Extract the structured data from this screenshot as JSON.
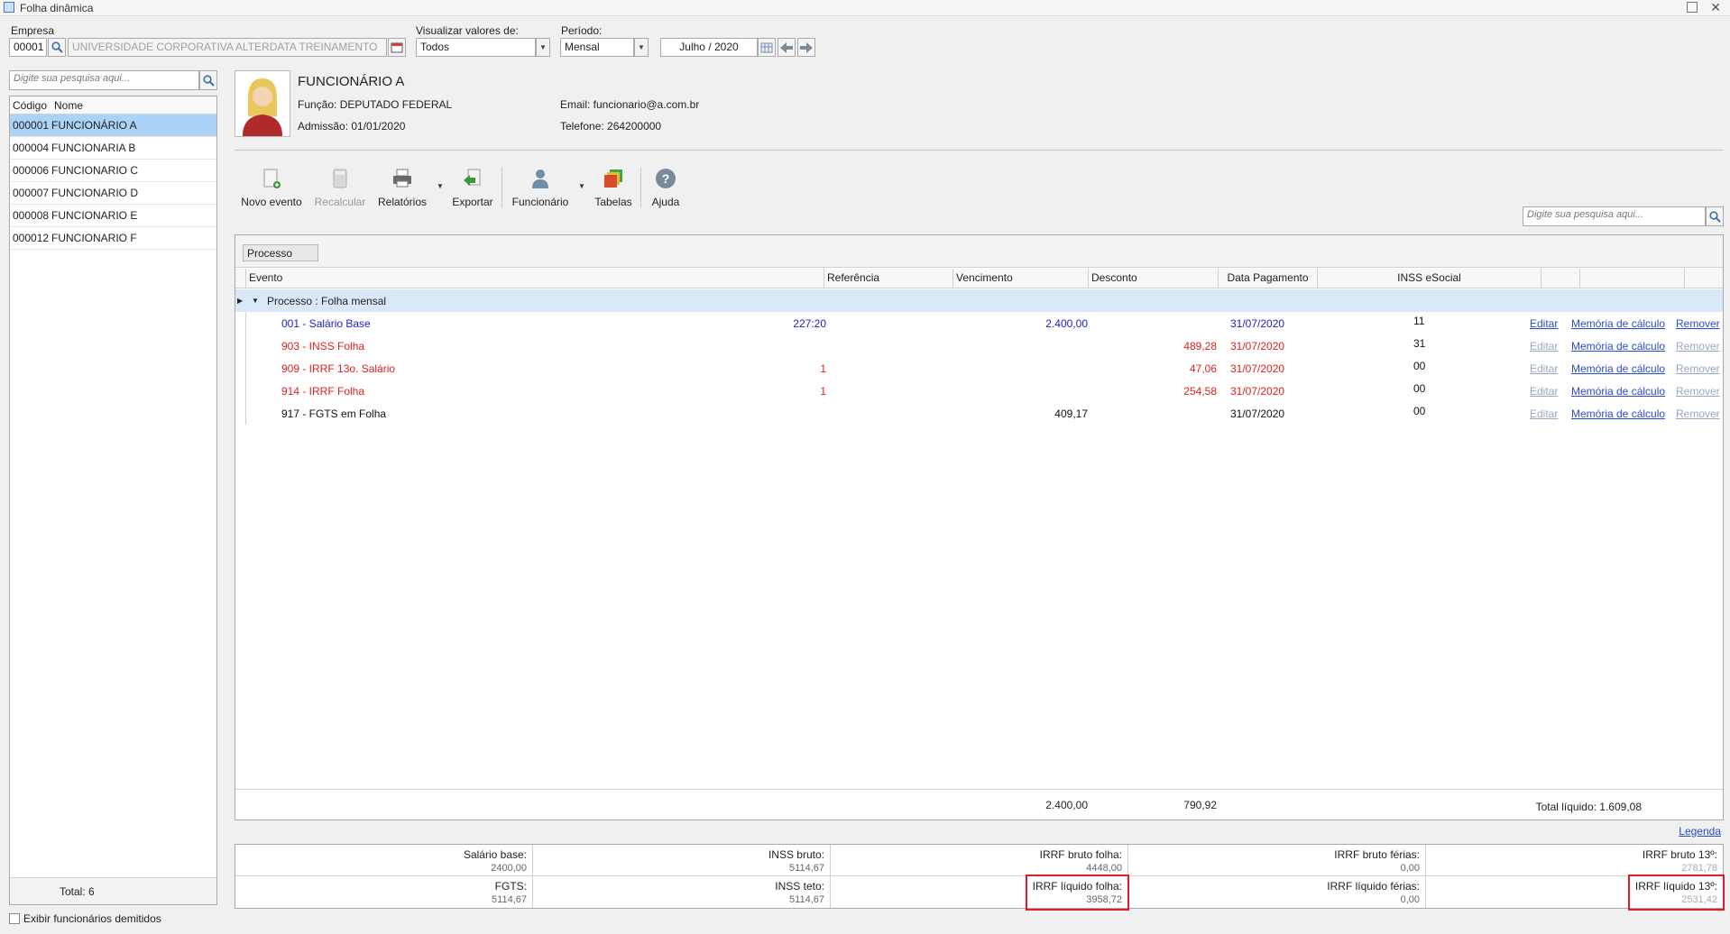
{
  "window": {
    "title": "Folha dinâmica"
  },
  "top": {
    "empresa_label": "Empresa",
    "empresa_code": "00001",
    "empresa_name": "UNIVERSIDADE CORPORATIVA ALTERDATA TREINAMENTO",
    "visualizar_label": "Visualizar valores de:",
    "visualizar_value": "Todos",
    "periodo_label": "Período:",
    "periodo_value": "Mensal",
    "periodo_date": "Julho / 2020"
  },
  "left": {
    "search_placeholder": "Digite sua pesquisa aqui...",
    "col_code": "Código",
    "col_name": "Nome",
    "employees": [
      {
        "code": "000001",
        "name": "FUNCIONÁRIO A"
      },
      {
        "code": "000004",
        "name": "FUNCIONARIA B"
      },
      {
        "code": "000006",
        "name": "FUNCIONARIO C"
      },
      {
        "code": "000007",
        "name": "FUNCIONARIO D"
      },
      {
        "code": "000008",
        "name": "FUNCIONARIO E"
      },
      {
        "code": "000012",
        "name": "FUNCIONARIO F"
      }
    ],
    "total": "Total: 6",
    "show_dismissed": "Exibir funcionários demitidos"
  },
  "employee": {
    "name": "FUNCIONÁRIO A",
    "funcao": "Função: DEPUTADO FEDERAL",
    "admissao": "Admissão:  01/01/2020",
    "email": "Email: funcionario@a.com.br",
    "telefone": "Telefone: 264200000"
  },
  "toolbar": {
    "novo_evento": "Novo evento",
    "recalcular": "Recalcular",
    "relatorios": "Relatórios",
    "exportar": "Exportar",
    "funcionario": "Funcionário",
    "tabelas": "Tabelas",
    "ajuda": "Ajuda",
    "search_placeholder": "Digite sua pesquisa aqui..."
  },
  "grid": {
    "group_chip": "Processo",
    "headers": {
      "evento": "Evento",
      "referencia": "Referência",
      "vencimento": "Vencimento",
      "desconto": "Desconto",
      "data_pagamento": "Data Pagamento",
      "inss_esocial": "INSS eSocial"
    },
    "group_label": "Processo : Folha mensal",
    "rows": [
      {
        "evento": "001 - Salário Base",
        "referencia": "227:20",
        "vencimento": "2.400,00",
        "desconto": "",
        "data": "31/07/2020",
        "inss": "11",
        "editar": "Editar",
        "memoria": "Memória de cálculo",
        "remover": "Remover"
      },
      {
        "evento": "903 - INSS Folha",
        "referencia": "",
        "vencimento": "",
        "desconto": "489,28",
        "data": "31/07/2020",
        "inss": "31",
        "editar": "Editar",
        "memoria": "Memória de cálculo",
        "remover": "Remover"
      },
      {
        "evento": "909 - IRRF 13o. Salário",
        "referencia": "1",
        "vencimento": "",
        "desconto": "47,06",
        "data": "31/07/2020",
        "inss": "00",
        "editar": "Editar",
        "memoria": "Memória de cálculo",
        "remover": "Remover"
      },
      {
        "evento": "914 - IRRF Folha",
        "referencia": "1",
        "vencimento": "",
        "desconto": "254,58",
        "data": "31/07/2020",
        "inss": "00",
        "editar": "Editar",
        "memoria": "Memória de cálculo",
        "remover": "Remover"
      },
      {
        "evento": "917 - FGTS em Folha",
        "referencia": "",
        "vencimento": "409,17",
        "desconto": "",
        "data": "31/07/2020",
        "inss": "00",
        "editar": "Editar",
        "memoria": "Memória de cálculo",
        "remover": "Remover"
      }
    ],
    "total_vencimento": "2.400,00",
    "total_desconto": "790,92",
    "total_liquido": "Total líquido: 1.609,08"
  },
  "legenda": "Legenda",
  "summary": {
    "row1": [
      {
        "label": "Salário base:",
        "value": "2400,00"
      },
      {
        "label": "INSS bruto:",
        "value": "5114,67"
      },
      {
        "label": "IRRF bruto folha:",
        "value": "4448,00"
      },
      {
        "label": "IRRF bruto férias:",
        "value": "0,00"
      },
      {
        "label": "IRRF bruto 13º:",
        "value": "2781,78"
      }
    ],
    "row2": [
      {
        "label": "FGTS:",
        "value": "5114,67"
      },
      {
        "label": "INSS teto:",
        "value": "5114,67"
      },
      {
        "label": "IRRF líquido folha:",
        "value": "3958,72"
      },
      {
        "label": "IRRF líquido férias:",
        "value": "0,00"
      },
      {
        "label": "IRRF líquido 13º:",
        "value": "2531,42"
      }
    ]
  }
}
